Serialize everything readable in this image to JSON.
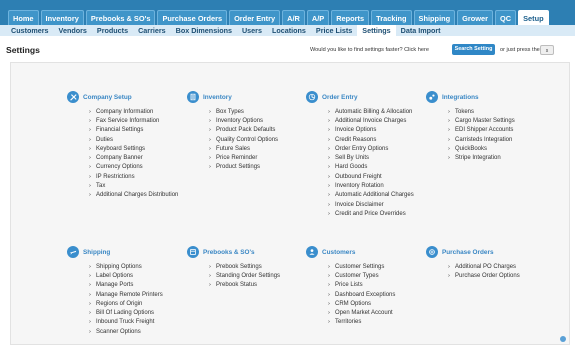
{
  "top_tabs": [
    "Home",
    "Inventory",
    "Prebooks & SO's",
    "Purchase Orders",
    "Order Entry",
    "A/R",
    "A/P",
    "Reports",
    "Tracking",
    "Shipping",
    "Grower",
    "QC",
    "Setup"
  ],
  "top_active": "Setup",
  "sub_tabs": [
    "Customers",
    "Vendors",
    "Products",
    "Carriers",
    "Box Dimensions",
    "Users",
    "Locations",
    "Price Lists",
    "Settings",
    "Data Import"
  ],
  "sub_active": "Settings",
  "header": {
    "title": "Settings",
    "find_text": "Would you like to find settings faster? Click here",
    "search_button": "Search Setting",
    "press_text": "or just press the",
    "key_label": "s"
  },
  "sections": [
    {
      "icon": "tools-icon",
      "title": "Company Setup",
      "items": [
        "Company Information",
        "Fax Service Information",
        "Financial Settings",
        "Duties",
        "Keyboard Settings",
        "Company Banner",
        "Currency Options",
        "IP Restrictions",
        "Tax",
        "Additional Charges Distribution"
      ]
    },
    {
      "icon": "inventory-icon",
      "title": "Inventory",
      "items": [
        "Box Types",
        "Inventory Options",
        "Product Pack Defaults",
        "Quality Control Options",
        "Future Sales",
        "Price Reminder",
        "Product Settings"
      ]
    },
    {
      "icon": "order-entry-icon",
      "title": "Order Entry",
      "items": [
        "Automatic Billing & Allocation",
        "Additional Invoice Charges",
        "Invoice Options",
        "Credit Reasons",
        "Order Entry Options",
        "Sell By Units",
        "Hard Goods",
        "Outbound Freight",
        "Inventory Rotation",
        "Automatic Additional Charges",
        "Invoice Disclaimer",
        "Credit and Price Overrides"
      ]
    },
    {
      "icon": "integrations-icon",
      "title": "Integrations",
      "items": [
        "Tokens",
        "Cargo Master Settings",
        "EDI Shipper Accounts",
        "Carristeds Integration",
        "QuickBooks",
        "Stripe Integration"
      ]
    },
    {
      "icon": "airplane-icon",
      "title": "Shipping",
      "items": [
        "Shipping Options",
        "Label Options",
        "Manage Ports",
        "Manage Remote Printers",
        "Regions of Origin",
        "Bill Of Lading Options",
        "Inbound Truck Freight",
        "Scanner Options"
      ]
    },
    {
      "icon": "prebook-icon",
      "title": "Prebooks & SO's",
      "items": [
        "Prebook Settings",
        "Standing Order Settings",
        "Prebook Status"
      ]
    },
    {
      "icon": "customers-icon",
      "title": "Customers",
      "items": [
        "Customer Settings",
        "Customer Types",
        "Price Lists",
        "Dashboard Exceptions",
        "CRM Options",
        "Open Market Account",
        "Territories"
      ]
    },
    {
      "icon": "purchase-orders-icon",
      "title": "Purchase Orders",
      "items": [
        "Additional PO Charges",
        "Purchase Order Options"
      ]
    }
  ],
  "colors": {
    "nav": "#2d7fb3",
    "accent": "#3a87c4",
    "subnav": "#d9eaf6"
  }
}
